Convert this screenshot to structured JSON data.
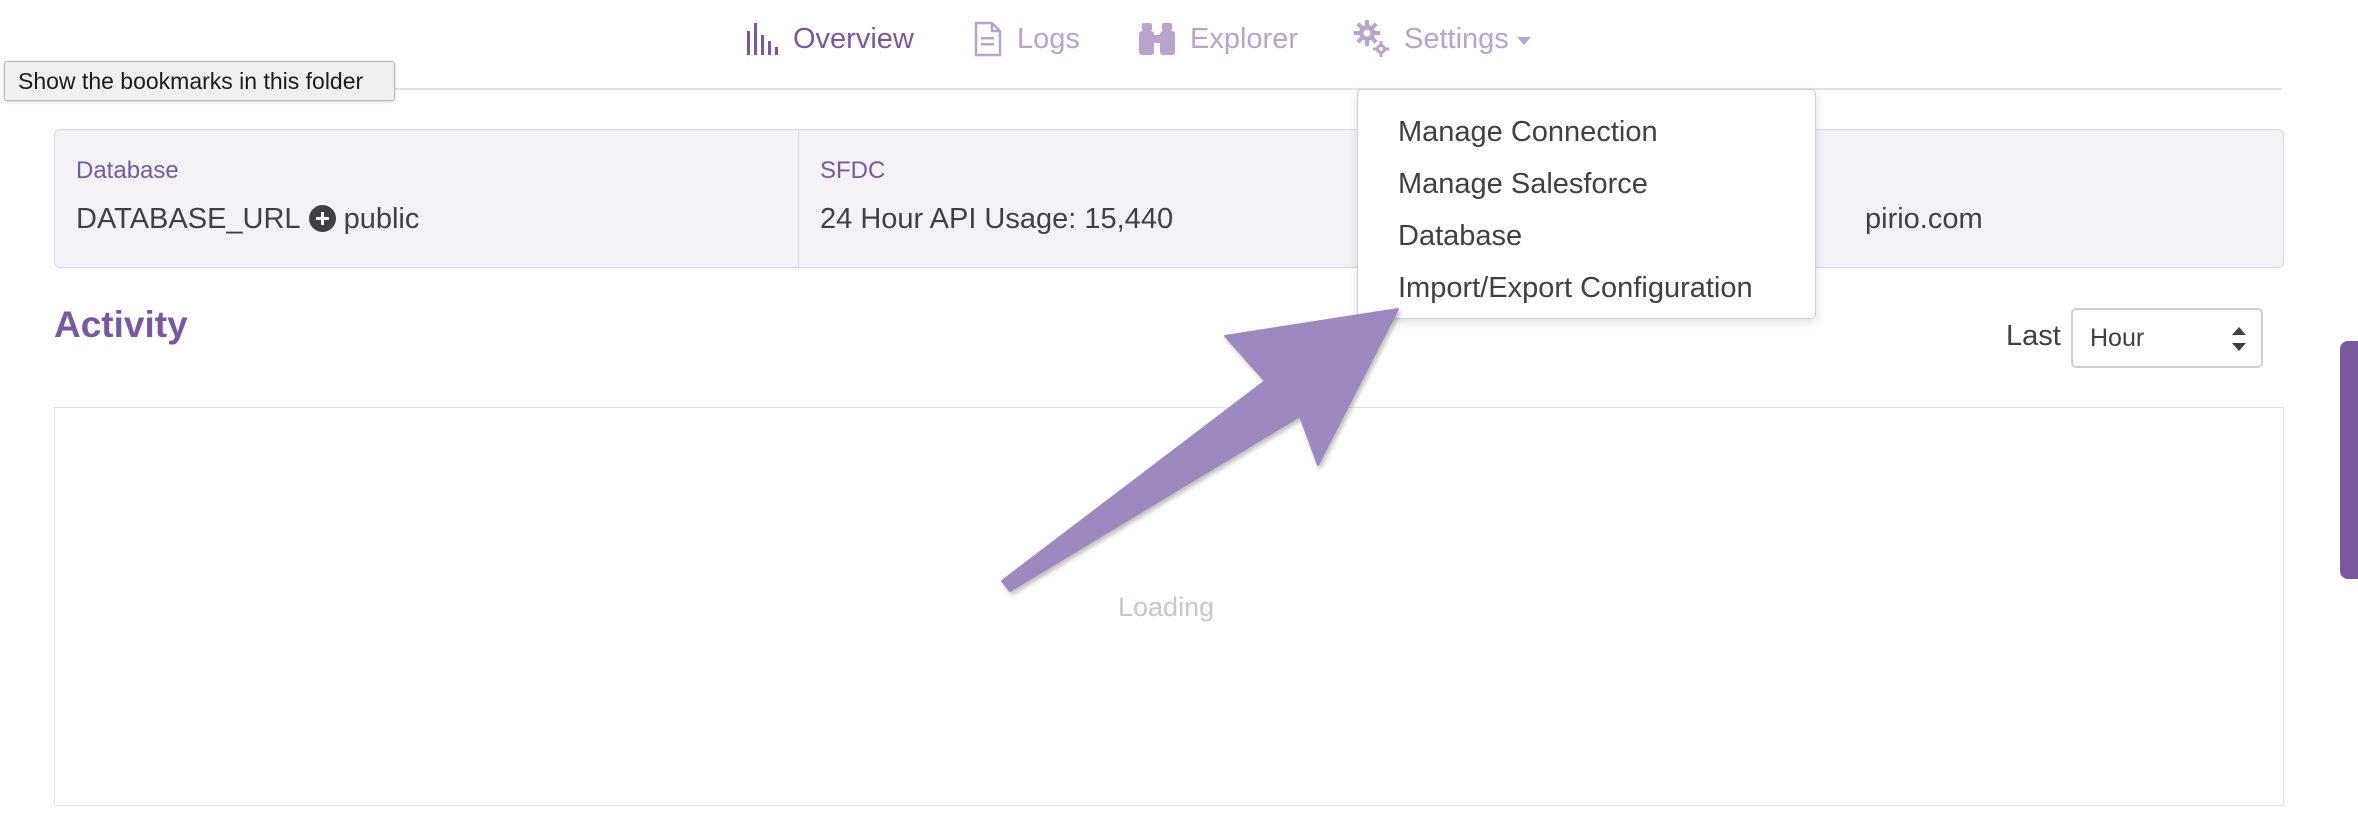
{
  "nav": {
    "items": [
      {
        "label": "Overview",
        "icon": "bar-chart-icon",
        "active": true
      },
      {
        "label": "Logs",
        "icon": "document-icon",
        "active": false
      },
      {
        "label": "Explorer",
        "icon": "binoculars-icon",
        "active": false
      },
      {
        "label": "Settings",
        "icon": "gear-icon",
        "active": false
      }
    ]
  },
  "tooltip": {
    "text": "Show the bookmarks in this folder"
  },
  "info": {
    "database": {
      "label": "Database",
      "value_url": "DATABASE_URL",
      "value_schema": "public"
    },
    "sfdc": {
      "label": "SFDC",
      "value": "24 Hour API Usage: 15,440"
    },
    "user": {
      "value": "pirio.com"
    }
  },
  "activity": {
    "title": "Activity",
    "last_label": "Last",
    "period": "Hour",
    "loading": "Loading"
  },
  "settings_menu": {
    "items": [
      "Manage Connection",
      "Manage Salesforce",
      "Database",
      "Import/Export Configuration"
    ]
  },
  "colors": {
    "accent": "#79589f",
    "accent_light": "#b8a3cc",
    "panel_bg": "#f3f2f7",
    "arrow": "#9d89bf"
  }
}
